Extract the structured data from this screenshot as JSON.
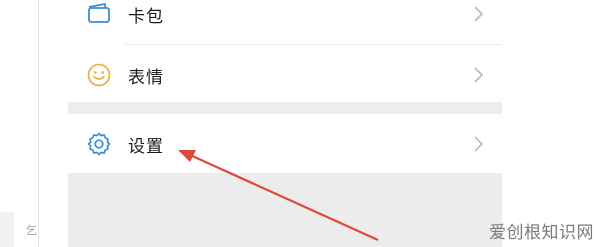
{
  "menu": {
    "items": [
      {
        "label": "卡包",
        "icon": "card-wallet-icon"
      },
      {
        "label": "表情",
        "icon": "emoji-smile-icon"
      },
      {
        "label": "设置",
        "icon": "gear-icon"
      }
    ]
  },
  "left_strip": {
    "glyph": "乞"
  },
  "watermark": "爱创根知识网",
  "colors": {
    "arrow": "#e0473a",
    "icon_blue": "#3a8ed6",
    "icon_yellow": "#e8b44a",
    "gray_bg": "#ececec",
    "text": "#1c1c1c"
  }
}
